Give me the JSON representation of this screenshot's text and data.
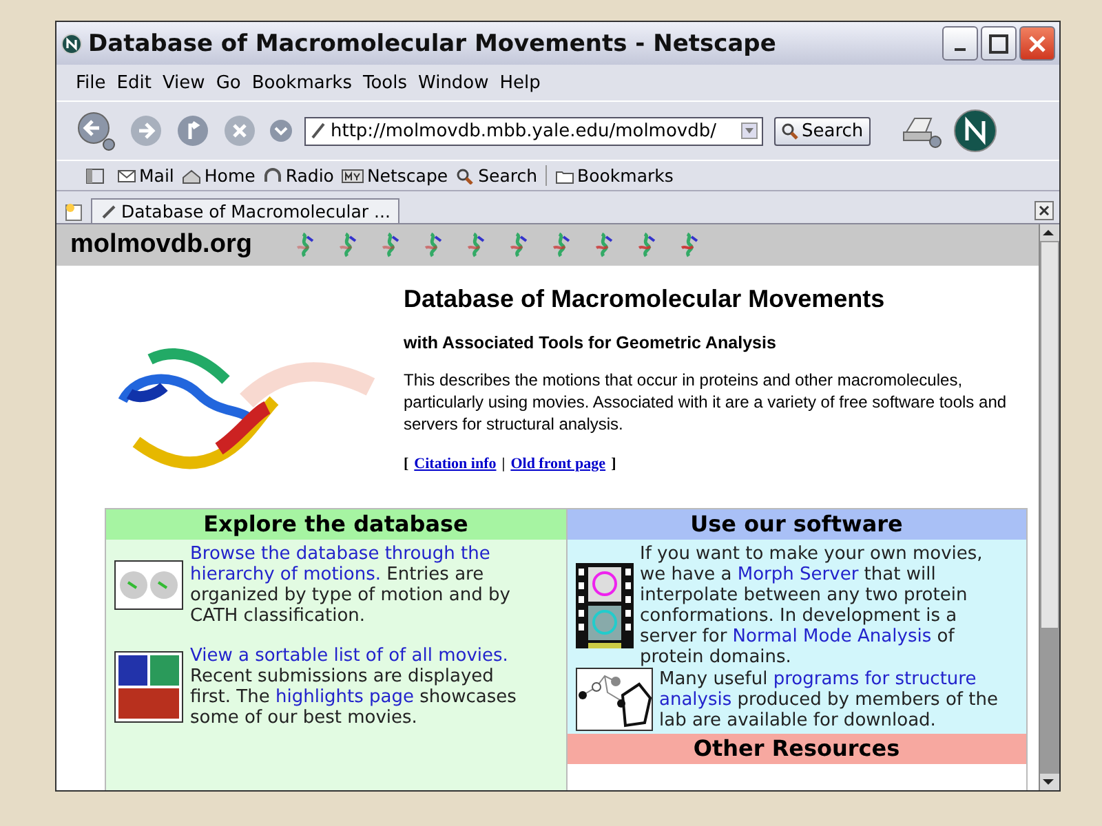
{
  "window": {
    "title": "Database of Macromolecular Movements - Netscape"
  },
  "menu": [
    "File",
    "Edit",
    "View",
    "Go",
    "Bookmarks",
    "Tools",
    "Window",
    "Help"
  ],
  "navigation": {
    "url": "http://molmovdb.mbb.yale.edu/molmovdb/",
    "search_button": "Search"
  },
  "personal_toolbar": [
    {
      "label": "Mail",
      "kind": "mail"
    },
    {
      "label": "Home",
      "kind": "home"
    },
    {
      "label": "Radio",
      "kind": "radio"
    },
    {
      "label": "Netscape",
      "kind": "netscape"
    },
    {
      "label": "Search",
      "kind": "search"
    },
    {
      "label": "Bookmarks",
      "kind": "folder"
    }
  ],
  "tabs": [
    {
      "label": "Database of Macromolecular  ...",
      "selected": true
    }
  ],
  "page": {
    "site_name": "molmovdb.org",
    "heading": "Database of Macromolecular Movements",
    "subheading": "with Associated Tools for Geometric Analysis",
    "description": "This describes the motions that occur in proteins and other macromolecules, particularly using movies. Associated with it are a variety of free software tools and servers for structural analysis.",
    "links_line": {
      "open": "[",
      "links": [
        "Citation info",
        "Old front page"
      ],
      "separator": "|",
      "close": "]"
    },
    "sections": [
      {
        "kind": "explore",
        "title": "Explore the database",
        "entries": [
          {
            "kind": "proteins",
            "runs": [
              {
                "text": "Browse the database through the",
                "link": true
              },
              {
                "text": "hierarchy of motions.",
                "link": true
              },
              {
                "text": " Entries are organized by type of motion and by CATH classification.",
                "link": false
              }
            ]
          },
          {
            "kind": "grid",
            "runs": [
              {
                "text": "View a sortable list of of all movies.",
                "link": true
              },
              {
                "text": " Recent submissions are displayed first. The ",
                "link": false
              },
              {
                "text": "highlights page",
                "link": true
              },
              {
                "text": " showcases some of our best movies.",
                "link": false
              }
            ]
          }
        ]
      },
      {
        "kind": "software",
        "title": "Use our software",
        "entries": [
          {
            "kind": "film",
            "runs": [
              {
                "text": "If you want to make your own movies, we have a ",
                "link": false
              },
              {
                "text": "Morph Server",
                "link": true
              },
              {
                "text": " that will interpolate between any two protein conformations. In development is a server for ",
                "link": false
              },
              {
                "text": "Normal",
                "link": true
              },
              {
                "text": "Mode Analysis",
                "link": true
              },
              {
                "text": " of protein domains.",
                "link": false
              }
            ]
          },
          {
            "kind": "molecule",
            "runs": [
              {
                "text": "Many useful ",
                "link": false
              },
              {
                "text": "programs for structure",
                "link": true
              },
              {
                "text": "analysis",
                "link": true
              },
              {
                "text": " produced by members of the lab are available for download.",
                "link": false
              }
            ]
          }
        ]
      },
      {
        "kind": "other",
        "title": "Other Resources"
      }
    ]
  }
}
